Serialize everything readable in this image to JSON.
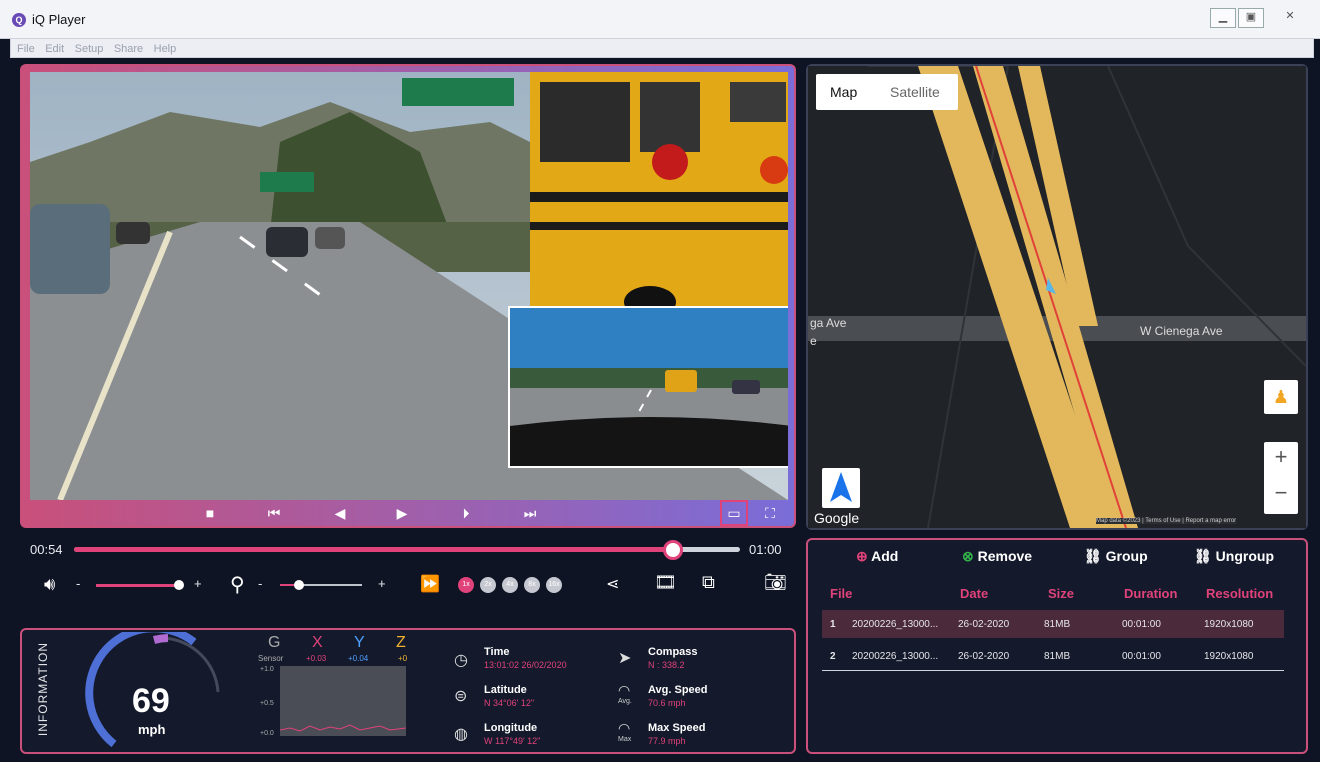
{
  "window": {
    "title": "iQ Player",
    "app_icon": "Q"
  },
  "menu": [
    "File",
    "Edit",
    "Setup",
    "Share",
    "Help"
  ],
  "video": {
    "current_time": "00:54",
    "total_time": "01:00",
    "progress": 0.9
  },
  "volume": {
    "minus": "-",
    "plus": "+",
    "level": 0.85
  },
  "zoom": {
    "minus": "-",
    "plus": "+",
    "level": 0.2
  },
  "speed_options": [
    "1x",
    "2x",
    "4x",
    "8x",
    "16x"
  ],
  "map": {
    "tab_map": "Map",
    "tab_satellite": "Satellite",
    "street_left": "ga Ave",
    "street_left2": "e",
    "street_right": "W Cienega Ave",
    "google": "Google",
    "zoom_in": "+",
    "zoom_out": "−",
    "footer": "Map data ©2023 | Terms of Use | Report a map error"
  },
  "files": {
    "add": "Add",
    "remove": "Remove",
    "group": "Group",
    "ungroup": "Ungroup",
    "headers": [
      "File",
      "Date",
      "Size",
      "Duration",
      "Resolution"
    ],
    "rows": [
      {
        "index": "1",
        "file": "20200226_13000...",
        "date": "26-02-2020",
        "size": "81MB",
        "duration": "00:01:00",
        "resolution": "1920x1080"
      },
      {
        "index": "2",
        "file": "20200226_13000...",
        "date": "26-02-2020",
        "size": "81MB",
        "duration": "00:01:00",
        "resolution": "1920x1080"
      }
    ]
  },
  "info": {
    "label": "INFORMATION",
    "speed": "69",
    "unit": "mph",
    "g_label": "G",
    "sensor_label": "Sensor",
    "x_label": "X",
    "x_val": "+0.03",
    "y_label": "Y",
    "y_val": "+0.04",
    "z_label": "Z",
    "z_val": "+0",
    "axis_ticks": [
      "+1.0",
      "+0.5",
      "+0.0"
    ],
    "time_label": "Time",
    "time_val": "13:01:02 26/02/2020",
    "lat_label": "Latitude",
    "lat_val": "N 34°06' 12\"",
    "lon_label": "Longitude",
    "lon_val": "W 117°49' 12\"",
    "compass_label": "Compass",
    "compass_val": "N : 338.2",
    "avg_label": "Avg. Speed",
    "avg_val": "70.6 mph",
    "avg_icon_text": "Avg.",
    "max_label": "Max Speed",
    "max_val": "77.9 mph",
    "max_icon_text": "Max"
  }
}
